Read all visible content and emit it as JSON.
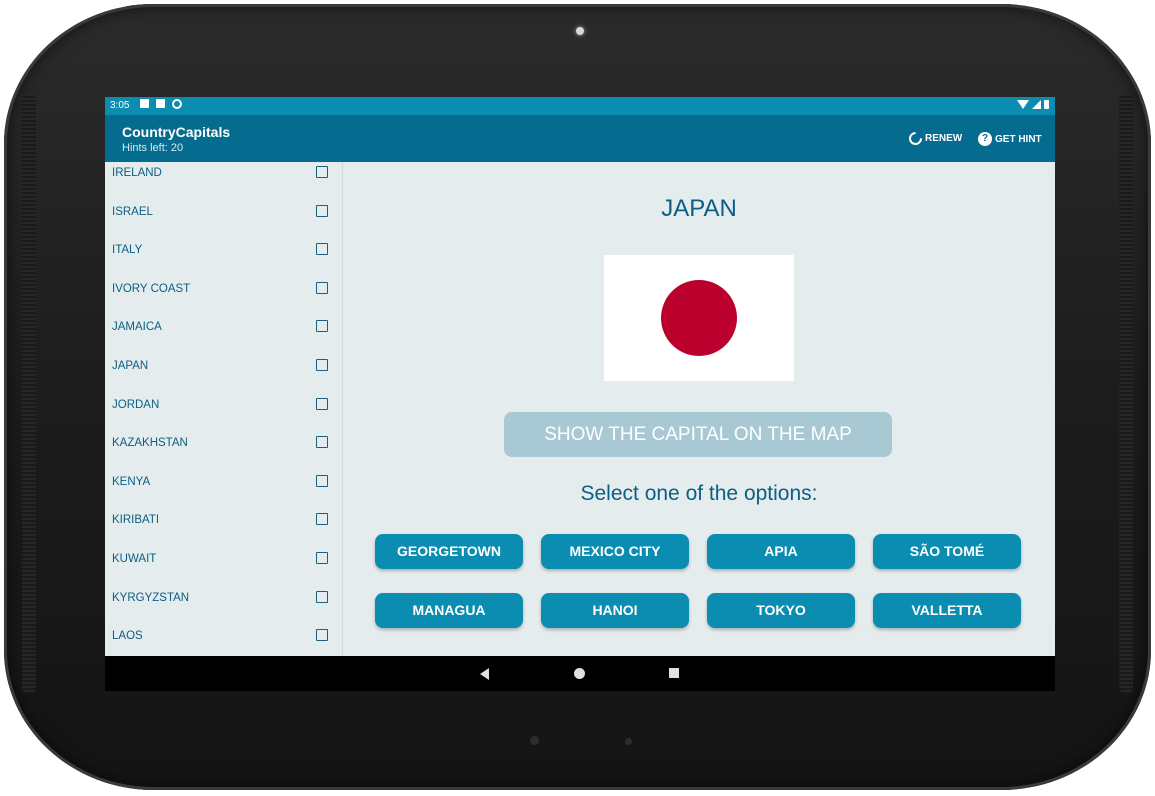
{
  "status_bar": {
    "time": "3:05",
    "icons_left": [
      "notification-a-icon",
      "sd-card-icon",
      "sync-icon"
    ],
    "icons_right": [
      "wifi-icon",
      "signal-icon",
      "battery-icon"
    ]
  },
  "app_bar": {
    "title": "CountryCapitals",
    "subtitle": "Hints left: 20",
    "renew_label": "RENEW",
    "hint_label": "GET HINT",
    "hint_icon_glyph": "?"
  },
  "countries": [
    {
      "name": "IRELAND",
      "checked": false
    },
    {
      "name": "ISRAEL",
      "checked": false
    },
    {
      "name": "ITALY",
      "checked": false
    },
    {
      "name": "IVORY COAST",
      "checked": false
    },
    {
      "name": "JAMAICA",
      "checked": false
    },
    {
      "name": "JAPAN",
      "checked": false
    },
    {
      "name": "JORDAN",
      "checked": false
    },
    {
      "name": "KAZAKHSTAN",
      "checked": false
    },
    {
      "name": "KENYA",
      "checked": false
    },
    {
      "name": "KIRIBATI",
      "checked": false
    },
    {
      "name": "KUWAIT",
      "checked": false
    },
    {
      "name": "KYRGYZSTAN",
      "checked": false
    },
    {
      "name": "LAOS",
      "checked": false
    }
  ],
  "quiz": {
    "country": "JAPAN",
    "flag_colors": {
      "field": "#ffffff",
      "disc": "#bc002d"
    },
    "show_map_label": "SHOW THE CAPITAL ON THE MAP",
    "prompt": "Select one of the options:",
    "options": [
      "GEORGETOWN",
      "MEXICO CITY",
      "APIA",
      "SÃO TOMÉ",
      "MANAGUA",
      "HANOI",
      "TOKYO",
      "VALLETTA"
    ]
  },
  "colors": {
    "status_bar": "#0b8db1",
    "app_bar": "#056c8f",
    "background": "#e5eced",
    "option_button": "#0b8db1",
    "map_button_disabled": "#a8c8d3",
    "title_text": "#0b5f84"
  },
  "nav_bar": {
    "icons": [
      "back-icon",
      "home-icon",
      "recent-apps-icon"
    ]
  }
}
